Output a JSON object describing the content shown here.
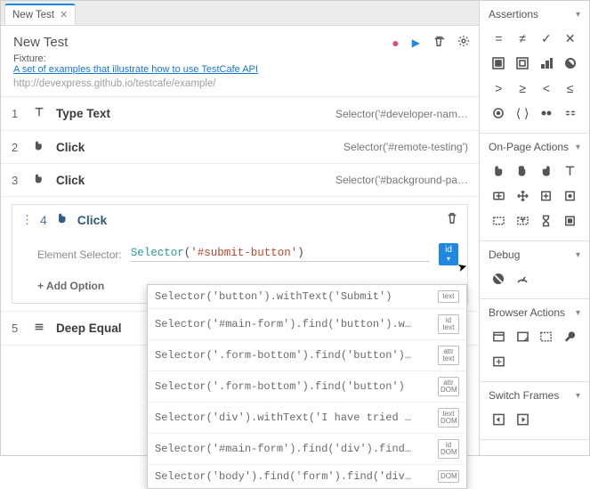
{
  "tab": {
    "title": "New Test"
  },
  "header": {
    "title": "New Test",
    "fixture_label": "Fixture:",
    "fixture_link": "A set of examples that illustrate how to use TestCafe API",
    "url": "http://devexpress.github.io/testcafe/example/"
  },
  "steps": [
    {
      "num": "1",
      "icon": "type-text",
      "name": "Type Text",
      "selector": "Selector('#developer-nam…"
    },
    {
      "num": "2",
      "icon": "click",
      "name": "Click",
      "selector": "Selector('#remote-testing')"
    },
    {
      "num": "3",
      "icon": "click",
      "name": "Click",
      "selector": "Selector('#background-pa…"
    }
  ],
  "active_step": {
    "num": "4",
    "name": "Click",
    "element_selector_label": "Element Selector:",
    "selector_fn": "Selector",
    "selector_arg": "'#submit-button'",
    "strategy_badge": "id",
    "add_option": "+ Add Option"
  },
  "next_step": {
    "num": "5",
    "name": "Deep Equal"
  },
  "dropdown": [
    {
      "code": "Selector('button').withText('Submit')",
      "badge": [
        "text"
      ]
    },
    {
      "code": "Selector('#main-form').find('button').w…",
      "badge": [
        "id",
        "text"
      ]
    },
    {
      "code": "Selector('.form-bottom').find('button')…",
      "badge": [
        "attr",
        "text"
      ]
    },
    {
      "code": "Selector('.form-bottom').find('button')",
      "badge": [
        "attr",
        "DOM"
      ]
    },
    {
      "code": "Selector('div').withText('I have tried …",
      "badge": [
        "text",
        "DOM"
      ]
    },
    {
      "code": "Selector('#main-form').find('div').find…",
      "badge": [
        "id",
        "DOM"
      ]
    },
    {
      "code": "Selector('body').find('form').find('div…",
      "badge": [
        "DOM"
      ]
    }
  ],
  "panels": {
    "assertions": "Assertions",
    "onpage": "On-Page Actions",
    "debug": "Debug",
    "browser": "Browser Actions",
    "frames": "Switch Frames"
  }
}
